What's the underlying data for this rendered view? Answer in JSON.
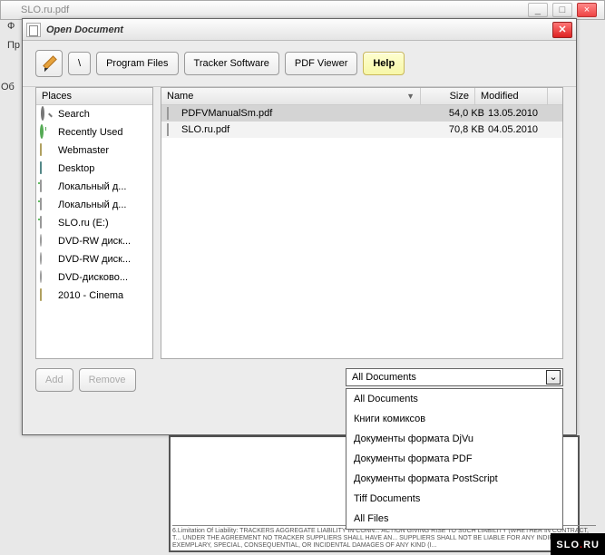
{
  "bg": {
    "title": "SLO.ru.pdf",
    "menu1": "Ф",
    "menu2": "Пр",
    "side1": "Об",
    "footer": "6.Limitation Of Liability: TRACKERS AGGREGATE LIABILITY IN CONN... ACTION GIVING RISE TO SUCH LIABILITY (WHETHER IN CONTRACT, T... UNDER THE AGREEMENT NO TRACKER SUPPLIERS SHALL HAVE AN... SUPPLIERS SHALL NOT BE LIABLE FOR ANY INDIRECT, EXEMPLARY, SPECIAL, CONSEQUENTIAL, OR INCIDENTAL DAMAGES OF ANY KIND (I...",
    "wm1": "SLO",
    "wm2": "RU"
  },
  "dialog": {
    "title": "Open Document",
    "path_root": "\\",
    "path_seg1": "Program Files",
    "path_seg2": "Tracker Software",
    "path_seg3": "PDF Viewer",
    "help": "Help"
  },
  "places": {
    "header": "Places",
    "items": [
      {
        "label": "Search",
        "icon": "search"
      },
      {
        "label": "Recently Used",
        "icon": "recent"
      },
      {
        "label": "Webmaster",
        "icon": "folder"
      },
      {
        "label": "Desktop",
        "icon": "desktop"
      },
      {
        "label": "Локальный д...",
        "icon": "drive"
      },
      {
        "label": "Локальный д...",
        "icon": "drive"
      },
      {
        "label": "SLO.ru (E:)",
        "icon": "drive"
      },
      {
        "label": "DVD-RW диск...",
        "icon": "dvd"
      },
      {
        "label": "DVD-RW диск...",
        "icon": "dvd"
      },
      {
        "label": "DVD-дисково...",
        "icon": "dvd"
      },
      {
        "label": "2010 - Cinema",
        "icon": "folder"
      }
    ]
  },
  "files": {
    "cols": {
      "name": "Name",
      "size": "Size",
      "modified": "Modified"
    },
    "rows": [
      {
        "name": "PDFVManualSm.pdf",
        "size": "54,0 KB",
        "modified": "13.05.2010",
        "selected": true
      },
      {
        "name": "SLO.ru.pdf",
        "size": "70,8 KB",
        "modified": "04.05.2010",
        "selected": false
      }
    ]
  },
  "buttons": {
    "add": "Add",
    "remove": "Remove"
  },
  "filter": {
    "selected": "All Documents",
    "options": [
      "All Documents",
      "Книги комиксов",
      "Документы формата DjVu",
      "Документы формата PDF",
      "Документы формата PostScript",
      "Tiff Documents",
      "All Files"
    ]
  }
}
